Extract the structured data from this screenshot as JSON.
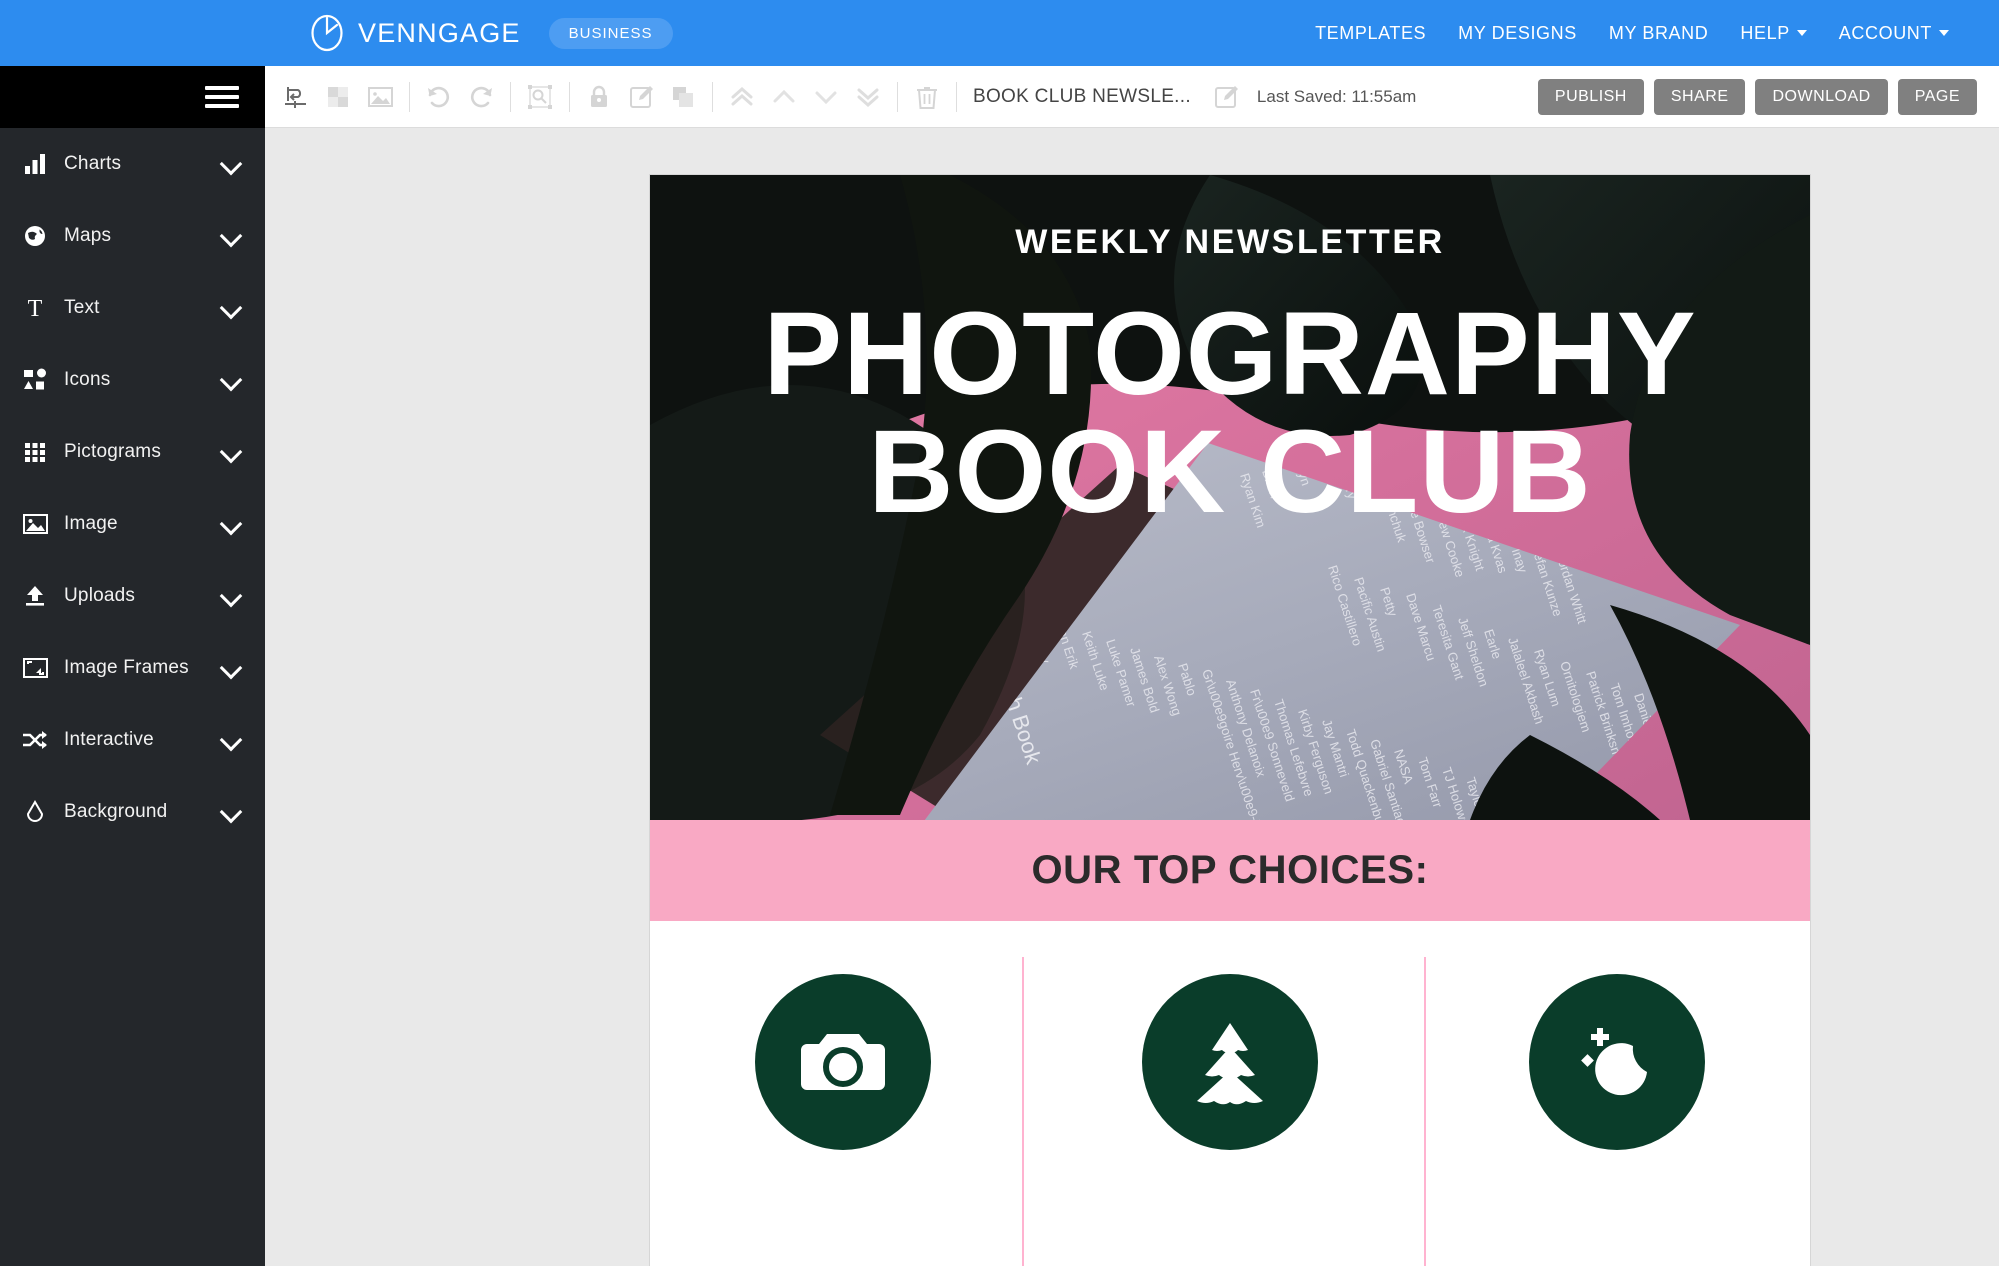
{
  "app": {
    "brand_name": "VENNGAGE",
    "plan_badge": "BUSINESS",
    "accent_blue": "#2d8cef",
    "sidebar_bg": "#24272b",
    "canvas_bg": "#e9e9e9"
  },
  "topnav": {
    "items": [
      {
        "label": "TEMPLATES",
        "has_caret": false
      },
      {
        "label": "MY DESIGNS",
        "has_caret": false
      },
      {
        "label": "MY BRAND",
        "has_caret": false
      },
      {
        "label": "HELP",
        "has_caret": true
      },
      {
        "label": "ACCOUNT",
        "has_caret": true
      }
    ]
  },
  "sidebar": {
    "menu_icon": "hamburger-icon",
    "items": [
      {
        "label": "Charts",
        "icon": "bar-chart-icon"
      },
      {
        "label": "Maps",
        "icon": "globe-icon"
      },
      {
        "label": "Text",
        "icon": "text-t-icon"
      },
      {
        "label": "Icons",
        "icon": "shapes-icon"
      },
      {
        "label": "Pictograms",
        "icon": "grid-dots-icon"
      },
      {
        "label": "Image",
        "icon": "picture-icon"
      },
      {
        "label": "Uploads",
        "icon": "upload-arrow-icon"
      },
      {
        "label": "Image Frames",
        "icon": "frame-icon"
      },
      {
        "label": "Interactive",
        "icon": "shuffle-arrows-icon"
      },
      {
        "label": "Background",
        "icon": "droplet-icon"
      }
    ]
  },
  "toolbar": {
    "tools": [
      {
        "name": "align-icon",
        "group": 1,
        "active": true
      },
      {
        "name": "crop-replace-icon",
        "group": 1,
        "active": false
      },
      {
        "name": "image-icon",
        "group": 1,
        "active": false
      },
      {
        "name": "undo-icon",
        "group": 2,
        "active": false
      },
      {
        "name": "redo-icon",
        "group": 2,
        "active": false
      },
      {
        "name": "resize-frame-icon",
        "group": 3,
        "active": false
      },
      {
        "name": "lock-icon",
        "group": 4,
        "active": false
      },
      {
        "name": "edit-pencil-icon",
        "group": 4,
        "active": false
      },
      {
        "name": "duplicate-icon",
        "group": 4,
        "active": false
      },
      {
        "name": "bring-to-front-icon",
        "group": 5,
        "active": false
      },
      {
        "name": "bring-forward-icon",
        "group": 5,
        "active": false
      },
      {
        "name": "send-backward-icon",
        "group": 5,
        "active": false
      },
      {
        "name": "send-to-back-icon",
        "group": 5,
        "active": false
      },
      {
        "name": "delete-trash-icon",
        "group": 6,
        "active": false
      }
    ],
    "document_title": "BOOK CLUB NEWSLE...",
    "rename_icon": "rename-pencil-icon",
    "last_saved": "Last Saved: 11:55am",
    "actions": [
      {
        "label": "PUBLISH",
        "name": "publish-button"
      },
      {
        "label": "SHARE",
        "name": "share-button"
      },
      {
        "label": "DOWNLOAD",
        "name": "download-button"
      },
      {
        "label": "PAGE",
        "name": "page-button"
      }
    ],
    "action_bg": "#808080"
  },
  "canvas": {
    "hero": {
      "eyebrow": "WEEKLY NEWSLETTER",
      "title_line1": "PHOTOGRAPHY",
      "title_line2": "BOOK CLUB",
      "photo_caption": "The Unsplash Book",
      "photo_alt": "photography-book-on-pink-background"
    },
    "band": {
      "text": "OUR TOP CHOICES:",
      "bg": "#f9a9c4",
      "text_color": "#2b2b2b"
    },
    "choices": {
      "circle_color": "#0a3d2a",
      "divider_color": "#ffb3d0",
      "items": [
        {
          "icon": "camera-icon"
        },
        {
          "icon": "pine-tree-icon"
        },
        {
          "icon": "moon-stars-icon"
        }
      ]
    }
  }
}
